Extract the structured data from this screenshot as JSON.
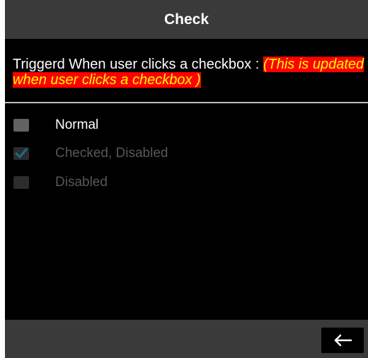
{
  "title": "Check",
  "description": {
    "text": "Triggerd When user clicks a checkbox : ",
    "highlight": "(This is updated when user clicks a checkbox )",
    "highlight_bg": "#ff0000",
    "highlight_fg": "#ffff00"
  },
  "checkboxes": [
    {
      "label": "Normal",
      "checked": false,
      "disabled": false
    },
    {
      "label": "Checked, Disabled",
      "checked": true,
      "disabled": true
    },
    {
      "label": "Disabled",
      "checked": false,
      "disabled": true
    }
  ],
  "back_button": {
    "icon": "arrow-left-icon"
  },
  "colors": {
    "background": "#000000",
    "bars": "#3a3a3a",
    "divider": "#bdbdbd",
    "check_accent": "#1f6a8a"
  }
}
